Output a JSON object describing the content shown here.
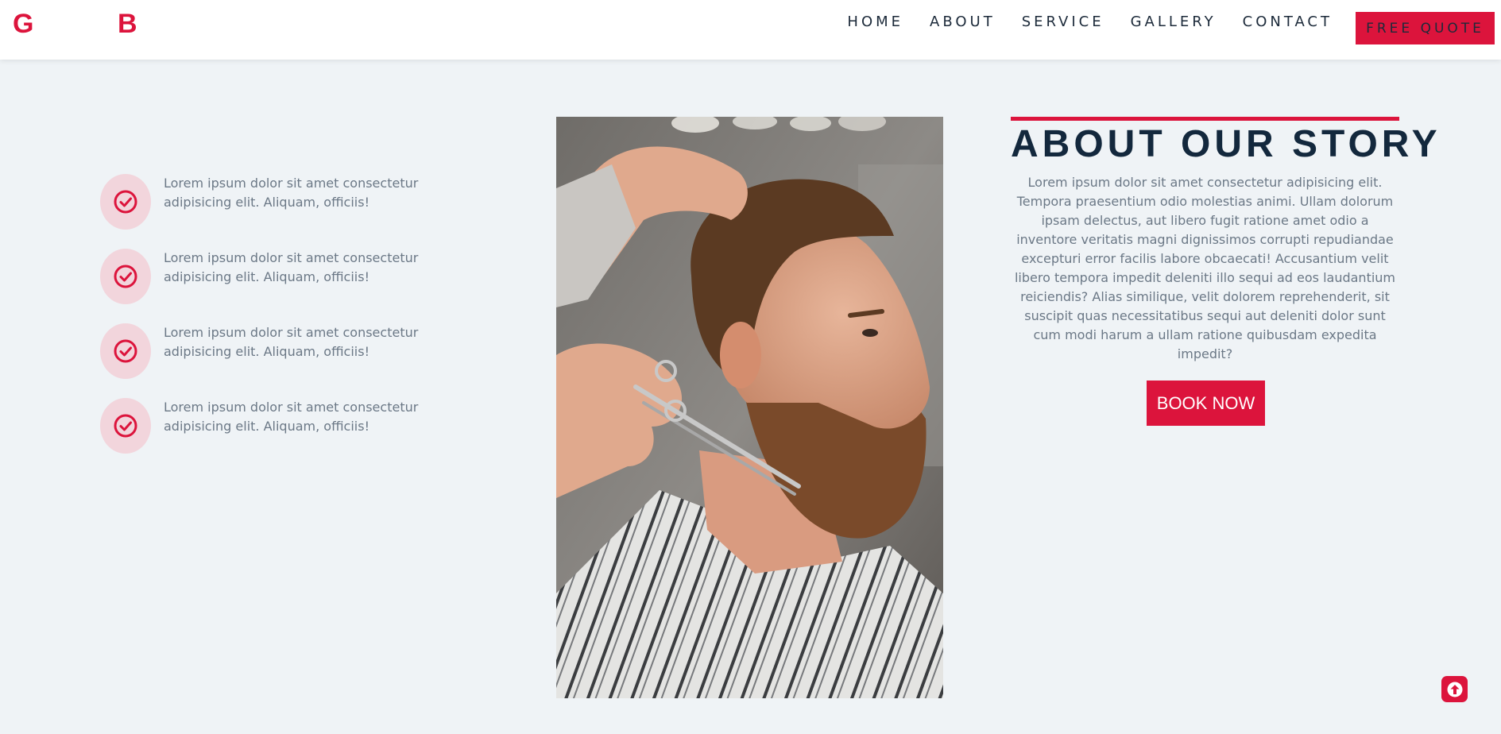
{
  "brand": {
    "logo_left": "G",
    "logo_right": "B",
    "color": "#dc143c"
  },
  "nav": {
    "links": [
      "HOME",
      "ABOUT",
      "SERVICE",
      "GALLERY",
      "CONTACT"
    ],
    "cta_label": "FREE QUOTE"
  },
  "features": {
    "items": [
      {
        "icon": "check-circle-icon",
        "text": "Lorem ipsum dolor sit amet consectetur adipisicing elit. Aliquam, officiis!"
      },
      {
        "icon": "check-circle-icon",
        "text": "Lorem ipsum dolor sit amet consectetur adipisicing elit. Aliquam, officiis!"
      },
      {
        "icon": "check-circle-icon",
        "text": "Lorem ipsum dolor sit amet consectetur adipisicing elit. Aliquam, officiis!"
      },
      {
        "icon": "check-circle-icon",
        "text": "Lorem ipsum dolor sit amet consectetur adipisicing elit. Aliquam, officiis!"
      }
    ]
  },
  "about": {
    "title": "ABOUT OUR STORY",
    "body": "Lorem ipsum dolor sit amet consectetur adipisicing elit. Tempora praesentium odio molestias animi. Ullam dolorum ipsam delectus, aut libero fugit ratione amet odio a inventore veritatis magni dignissimos corrupti repudiandae excepturi error facilis labore obcaecati! Accusantium velit libero tempora impedit deleniti illo sequi ad eos laudantium reiciendis? Alias similique, velit dolorem reprehenderit, sit suscipit quas necessitatibus sequi aut deleniti dolor sunt cum modi harum a ullam ratione quibusdam expedita impedit?",
    "button_label": "BOOK NOW"
  },
  "scroll_top": {
    "icon": "arrow-up-icon"
  },
  "colors": {
    "accent": "#dc143c",
    "heading": "#13283d",
    "body_text": "#6b7886",
    "background": "#eff3f6"
  }
}
